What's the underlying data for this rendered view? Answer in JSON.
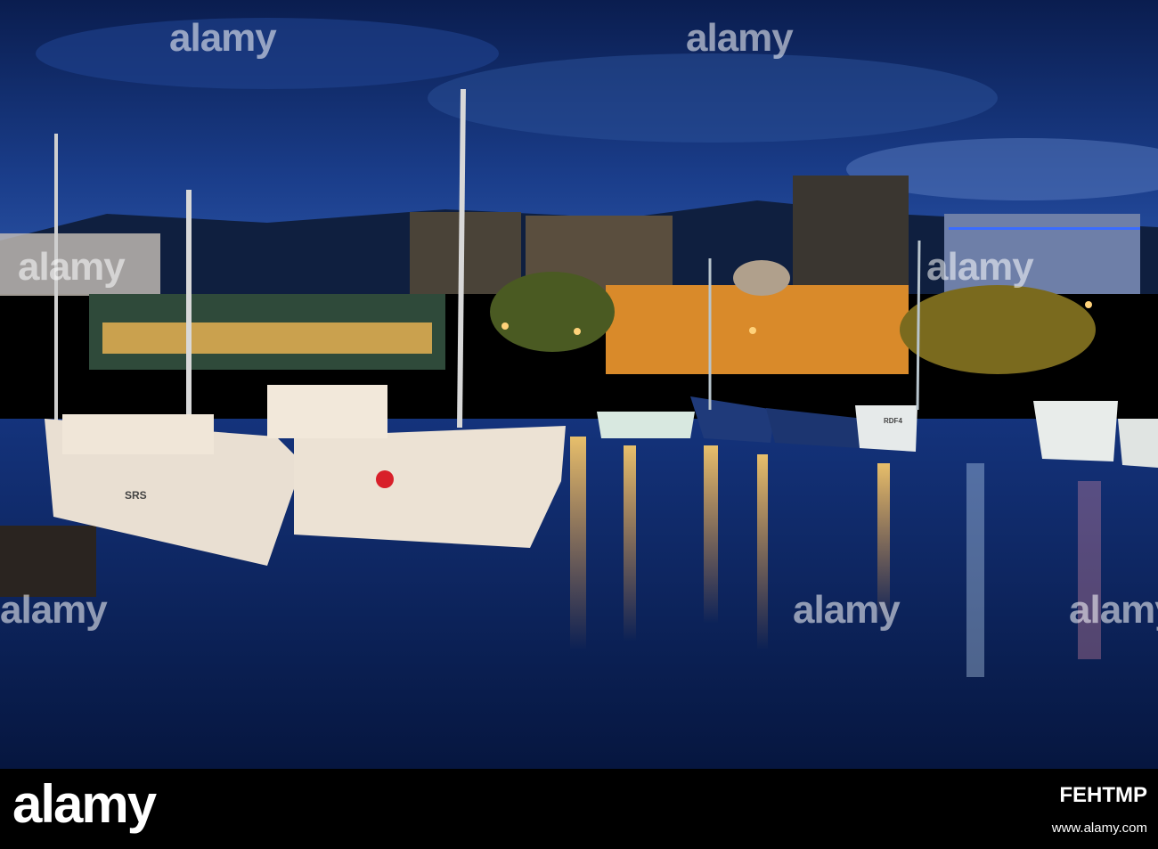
{
  "photo": {
    "boat_labels": [
      "SRS",
      "RDF4"
    ],
    "colors": {
      "sky_top": "#0a1d4f",
      "sky_mid": "#1a3d8a",
      "water": "#0c2a6e",
      "lights": "#ffb347",
      "building_lit": "#d98a2a"
    }
  },
  "watermarks": [
    {
      "text": "alamy"
    },
    {
      "text": "alamy"
    },
    {
      "text": "alamy"
    },
    {
      "text": "alamy"
    },
    {
      "text": "alamy"
    },
    {
      "text": "alamy"
    },
    {
      "text": "alamy"
    }
  ],
  "footer": {
    "brand": "alamy",
    "image_id": "FEHTMP",
    "caption": "www.alamy.com"
  }
}
